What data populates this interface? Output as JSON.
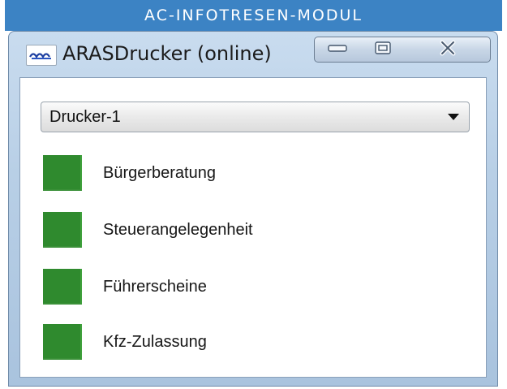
{
  "banner": {
    "text": "AC-INFOTRESEN-MODUL"
  },
  "window": {
    "title": "ARASDrucker (online)",
    "icon": "aras-logo-icon",
    "controls": {
      "minimize": "minimize-icon",
      "maximize": "maximize-icon",
      "close": "close-icon"
    }
  },
  "printer_select": {
    "value": "Drucker-1"
  },
  "items": [
    {
      "label": "Bürgerberatung",
      "color": "#2f8a2e"
    },
    {
      "label": "Steuerangelegenheit",
      "color": "#2f8a2e"
    },
    {
      "label": "Führerscheine",
      "color": "#2f8a2e"
    },
    {
      "label": "Kfz-Zulassung",
      "color": "#2f8a2e"
    }
  ],
  "colors": {
    "banner": "#3c83c4",
    "window_frame": "#b8cfe6",
    "status_green": "#2f8a2e"
  }
}
